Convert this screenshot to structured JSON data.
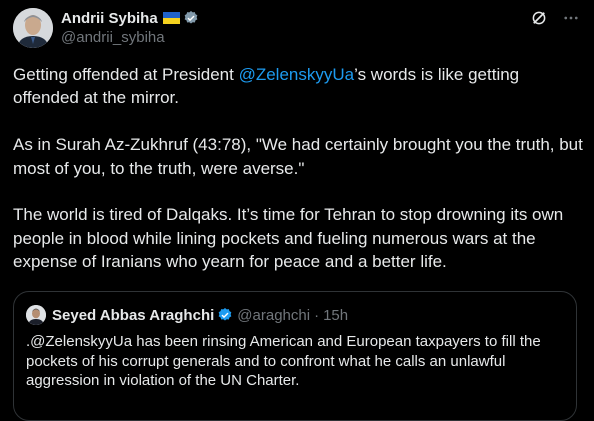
{
  "author": {
    "name": "Andrii Sybiha",
    "handle": "@andrii_sybiha"
  },
  "post": {
    "p1_before": "Getting offended at President ",
    "p1_mention": "@ZelenskyyUa",
    "p1_after": "’s words is like getting offended at the mirror.",
    "p2": "As in Surah Az-Zukhruf (43:78), \"We had certainly brought you the truth, but most of you, to the truth, were averse.\"",
    "p3": "The world is tired of Dalqaks. It’s time for Tehran to stop drowning its own people in blood while lining pockets and fueling numerous wars at the expense of Iranians who yearn for peace and a better life."
  },
  "quote": {
    "name": "Seyed Abbas Araghchi",
    "handle": "@araghchi",
    "separator": "·",
    "time": "15h",
    "text": ".@ZelenskyyUa has been rinsing American and European taxpayers to fill the pockets of his corrupt generals and to confront what he calls an unlawful aggression in violation of the UN Charter."
  },
  "icons": {
    "flag": "ukraine-flag-icon",
    "verified": "verified-badge-icon",
    "grok": "grok-icon",
    "more": "more-options-icon"
  },
  "colors": {
    "background": "#000000",
    "text": "#e7e9ea",
    "secondary": "#71767b",
    "accent": "#1d9bf0",
    "border": "#2f3336"
  }
}
